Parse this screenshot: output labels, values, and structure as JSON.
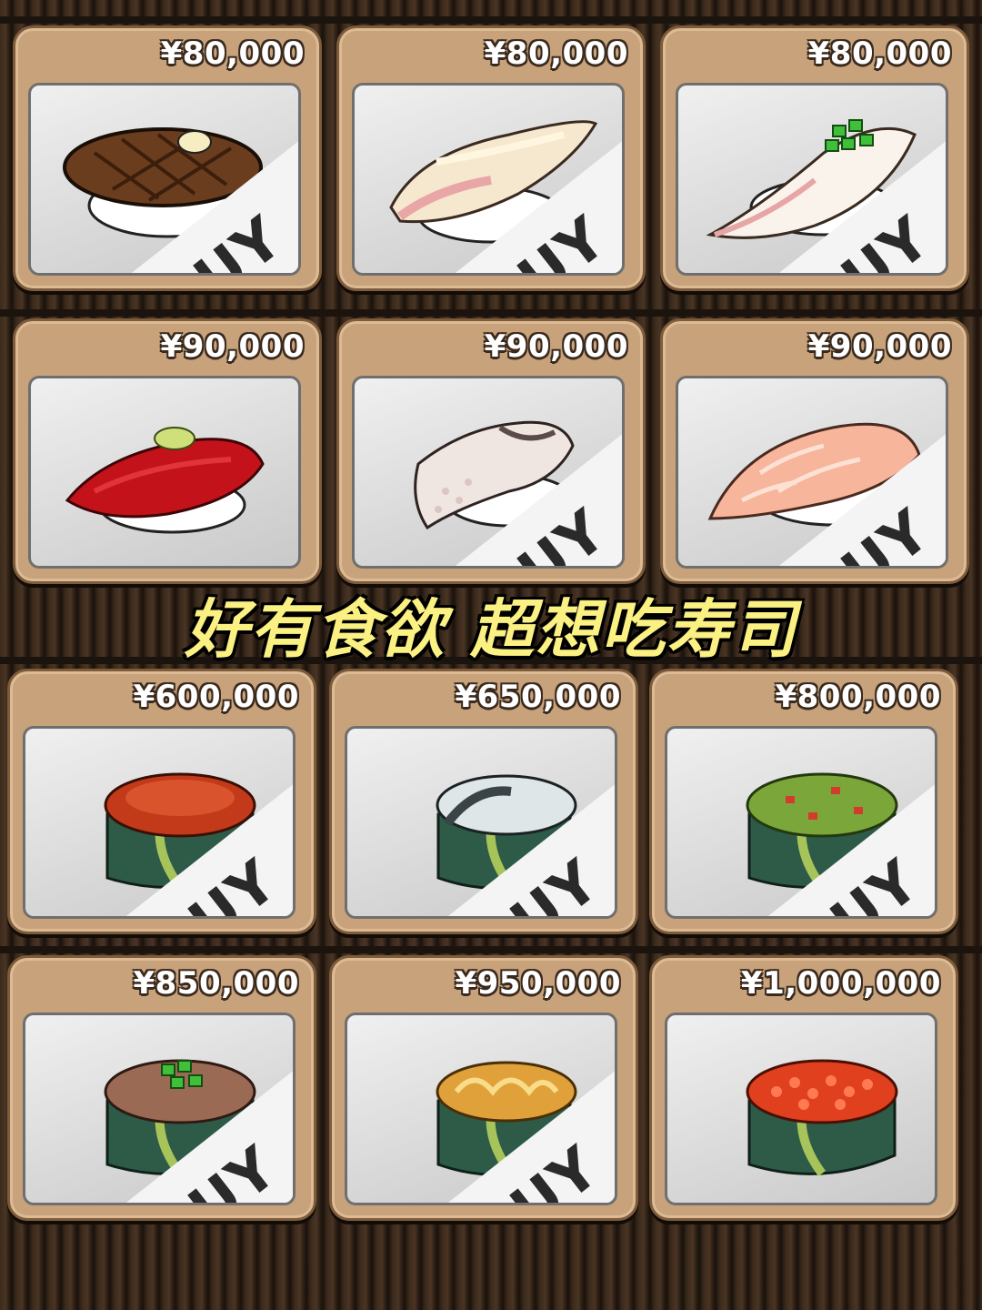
{
  "caption": "好有食欲 超想吃寿司",
  "buy_label": "BUY",
  "colors": {
    "card": "#c8a27a",
    "caption": "#fbf082",
    "price_text": "#ffffff"
  },
  "items": [
    {
      "price": "¥80,000",
      "icon": "grilled-beef-nigiri-icon"
    },
    {
      "price": "¥80,000",
      "icon": "yellowtail-nigiri-icon"
    },
    {
      "price": "¥80,000",
      "icon": "white-fish-scallion-nigiri-icon"
    },
    {
      "price": "¥90,000",
      "icon": "tuna-nigiri-icon"
    },
    {
      "price": "¥90,000",
      "icon": "octopus-nigiri-icon"
    },
    {
      "price": "¥90,000",
      "icon": "salmon-nigiri-icon"
    },
    {
      "price": "¥600,000",
      "icon": "tobiko-gunkan-icon"
    },
    {
      "price": "¥650,000",
      "icon": "oyster-gunkan-icon"
    },
    {
      "price": "¥800,000",
      "icon": "avocado-gunkan-icon"
    },
    {
      "price": "¥850,000",
      "icon": "negitoro-gunkan-icon"
    },
    {
      "price": "¥950,000",
      "icon": "sea-urchin-gunkan-icon"
    },
    {
      "price": "¥1,000,000",
      "icon": "salmon-roe-gunkan-icon"
    }
  ]
}
